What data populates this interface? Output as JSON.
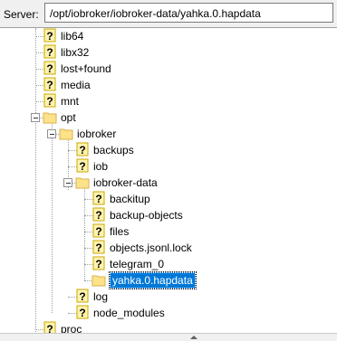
{
  "pathbar": {
    "label": "Server:",
    "path": "/opt/iobroker/iobroker-data/yahka.0.hapdata"
  },
  "tree": {
    "items": [
      {
        "label": "lib64",
        "type": "unknown"
      },
      {
        "label": "libx32",
        "type": "unknown"
      },
      {
        "label": "lost+found",
        "type": "unknown"
      },
      {
        "label": "media",
        "type": "unknown"
      },
      {
        "label": "mnt",
        "type": "unknown"
      },
      {
        "label": "opt",
        "type": "folder"
      },
      {
        "label": "iobroker",
        "type": "folder"
      },
      {
        "label": "backups",
        "type": "unknown"
      },
      {
        "label": "iob",
        "type": "unknown"
      },
      {
        "label": "iobroker-data",
        "type": "folder"
      },
      {
        "label": "backitup",
        "type": "unknown"
      },
      {
        "label": "backup-objects",
        "type": "unknown"
      },
      {
        "label": "files",
        "type": "unknown"
      },
      {
        "label": "objects.jsonl.lock",
        "type": "unknown"
      },
      {
        "label": "telegram_0",
        "type": "unknown"
      },
      {
        "label": "yahka.0.hapdata",
        "type": "folder",
        "selected": true
      },
      {
        "label": "log",
        "type": "unknown"
      },
      {
        "label": "node_modules",
        "type": "unknown"
      },
      {
        "label": "proc",
        "type": "unknown"
      }
    ]
  }
}
